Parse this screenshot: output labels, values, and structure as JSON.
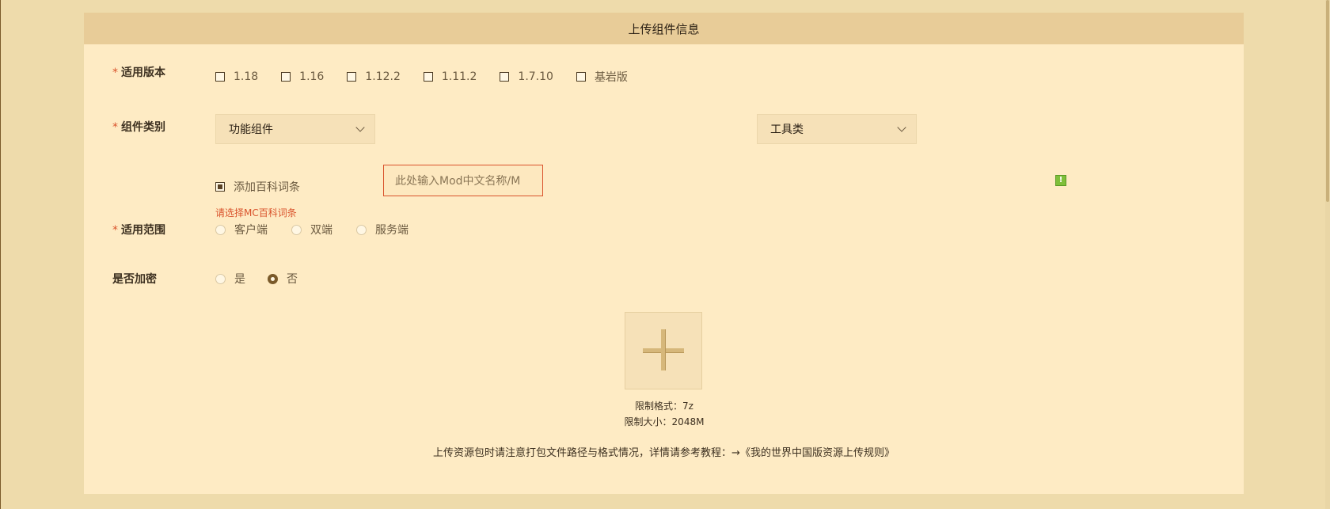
{
  "header": {
    "title": "上传组件信息"
  },
  "version": {
    "label": "适用版本",
    "required_mark": "*",
    "options": [
      {
        "label": "1.18",
        "checked": false
      },
      {
        "label": "1.16",
        "checked": false
      },
      {
        "label": "1.12.2",
        "checked": false
      },
      {
        "label": "1.11.2",
        "checked": false
      },
      {
        "label": "1.7.10",
        "checked": false
      },
      {
        "label": "基岩版",
        "checked": false
      }
    ]
  },
  "category": {
    "label": "组件类别",
    "required_mark": "*",
    "primary_value": "功能组件",
    "secondary_value": "工具类"
  },
  "wiki": {
    "checkbox_label": "添加百科词条",
    "checked": true,
    "input_value": "此处输入Mod中文名称/M",
    "error": "请选择MC百科词条",
    "warn_glyph": "!"
  },
  "scope": {
    "label": "适用范围",
    "required_mark": "*",
    "options": [
      "客户端",
      "双端",
      "服务端"
    ]
  },
  "encrypt": {
    "label": "是否加密",
    "options": [
      "是",
      "否"
    ],
    "selected": "否"
  },
  "upload": {
    "format_limit": "限制格式：7z",
    "size_limit": "限制大小：2048M",
    "note": "上传资源包时请注意打包文件路径与格式情况，详情请参考教程：→《我的世界中国版资源上传规则》"
  },
  "colors": {
    "background": "#eedbab",
    "card": "#feebc4",
    "header": "#e8cc98",
    "error": "#d9532c"
  }
}
